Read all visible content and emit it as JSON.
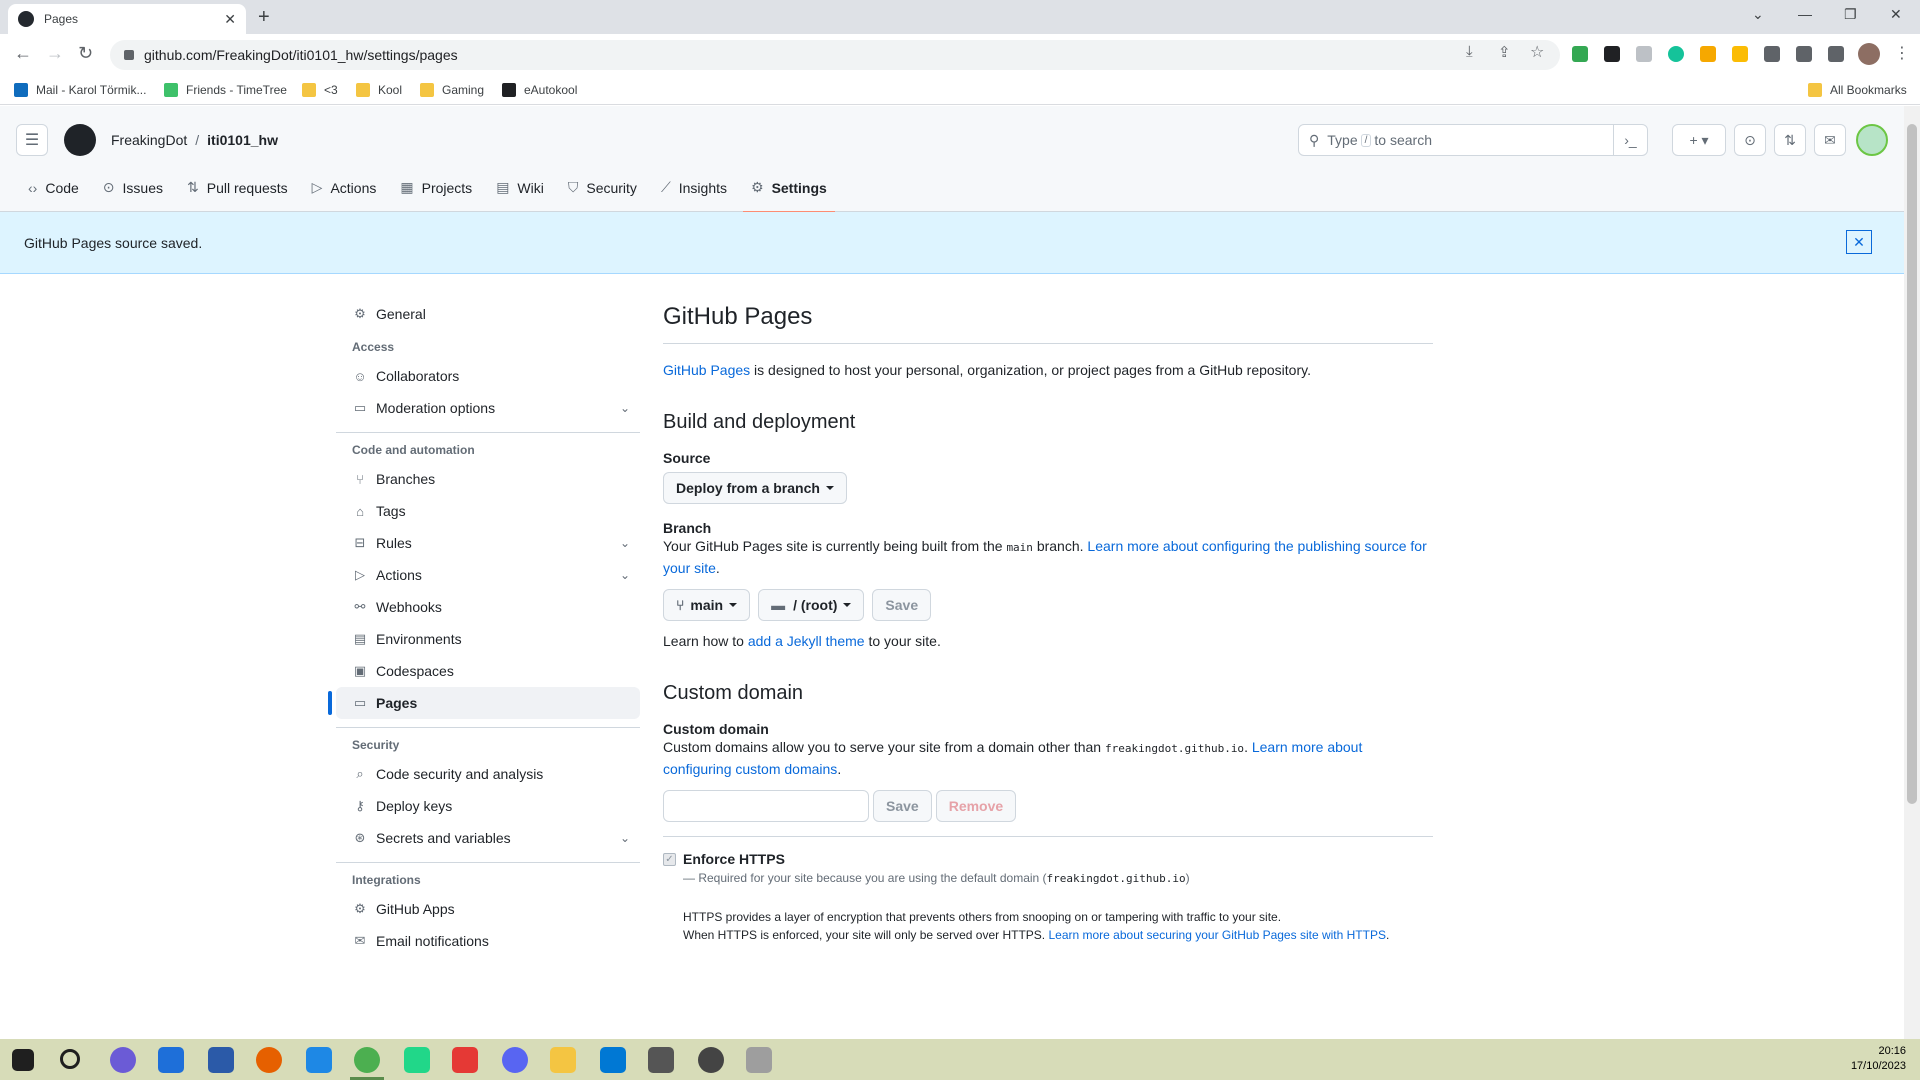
{
  "browser": {
    "tab_title": "Pages",
    "url": "github.com/FreakingDot/iti0101_hw/settings/pages",
    "bookmarks": [
      "Mail - Karol Törmik...",
      "Friends - TimeTree",
      "<3",
      "Kool",
      "Gaming",
      "eAutokool"
    ],
    "all_bookmarks": "All Bookmarks"
  },
  "header": {
    "owner": "FreakingDot",
    "separator": "/",
    "repo": "iti0101_hw",
    "search_prefix": "Type",
    "search_slash": "/",
    "search_suffix": "to search"
  },
  "repo_nav": [
    {
      "label": "Code",
      "icon": "code-icon"
    },
    {
      "label": "Issues",
      "icon": "issue-icon"
    },
    {
      "label": "Pull requests",
      "icon": "pull-request-icon"
    },
    {
      "label": "Actions",
      "icon": "play-icon"
    },
    {
      "label": "Projects",
      "icon": "table-icon"
    },
    {
      "label": "Wiki",
      "icon": "book-icon"
    },
    {
      "label": "Security",
      "icon": "shield-icon"
    },
    {
      "label": "Insights",
      "icon": "graph-icon"
    },
    {
      "label": "Settings",
      "icon": "gear-icon"
    }
  ],
  "flash": {
    "message": "GitHub Pages source saved."
  },
  "sidebar": {
    "general": "General",
    "access_heading": "Access",
    "collaborators": "Collaborators",
    "moderation": "Moderation options",
    "code_heading": "Code and automation",
    "branches": "Branches",
    "tags": "Tags",
    "rules": "Rules",
    "actions": "Actions",
    "webhooks": "Webhooks",
    "environments": "Environments",
    "codespaces": "Codespaces",
    "pages": "Pages",
    "security_heading": "Security",
    "code_security": "Code security and analysis",
    "deploy_keys": "Deploy keys",
    "secrets": "Secrets and variables",
    "integrations_heading": "Integrations",
    "github_apps": "GitHub Apps",
    "email_notifications": "Email notifications"
  },
  "main": {
    "title": "GitHub Pages",
    "intro_link": "GitHub Pages",
    "intro_text": " is designed to host your personal, organization, or project pages from a GitHub repository.",
    "build_heading": "Build and deployment",
    "source_label": "Source",
    "source_value": "Deploy from a branch",
    "branch_label": "Branch",
    "branch_text_1": "Your GitHub Pages site is currently being built from the ",
    "branch_code": "main",
    "branch_text_2": " branch. ",
    "branch_link": "Learn more about configuring the publishing source for your site",
    "branch_text_3": ".",
    "branch_select": "main",
    "folder_select": "/ (root)",
    "save_label": "Save",
    "jekyll_text_1": "Learn how to ",
    "jekyll_link": "add a Jekyll theme",
    "jekyll_text_2": " to your site.",
    "custom_heading": "Custom domain",
    "custom_label": "Custom domain",
    "custom_text_1": "Custom domains allow you to serve your site from a domain other than ",
    "custom_code": "freakingdot.github.io",
    "custom_text_2": ". ",
    "custom_link": "Learn more about configuring custom domains",
    "custom_text_3": ".",
    "custom_input_value": "",
    "custom_save": "Save",
    "custom_remove": "Remove",
    "https_label": "Enforce HTTPS",
    "https_note_1": "— Required for your site because you are using the default domain (",
    "https_note_code": "freakingdot.github.io",
    "https_note_2": ")",
    "https_desc_1": "HTTPS provides a layer of encryption that prevents others from snooping on or tampering with traffic to your site.",
    "https_desc_2": "When HTTPS is enforced, your site will only be served over HTTPS. ",
    "https_link": "Learn more about securing your GitHub Pages site with HTTPS",
    "https_desc_3": "."
  },
  "taskbar": {
    "time": "20:16",
    "date": "17/10/2023"
  },
  "colors": {
    "accent": "#0969da",
    "active_tab_underline": "#fd8c73",
    "flash_bg": "#ddf4ff"
  }
}
